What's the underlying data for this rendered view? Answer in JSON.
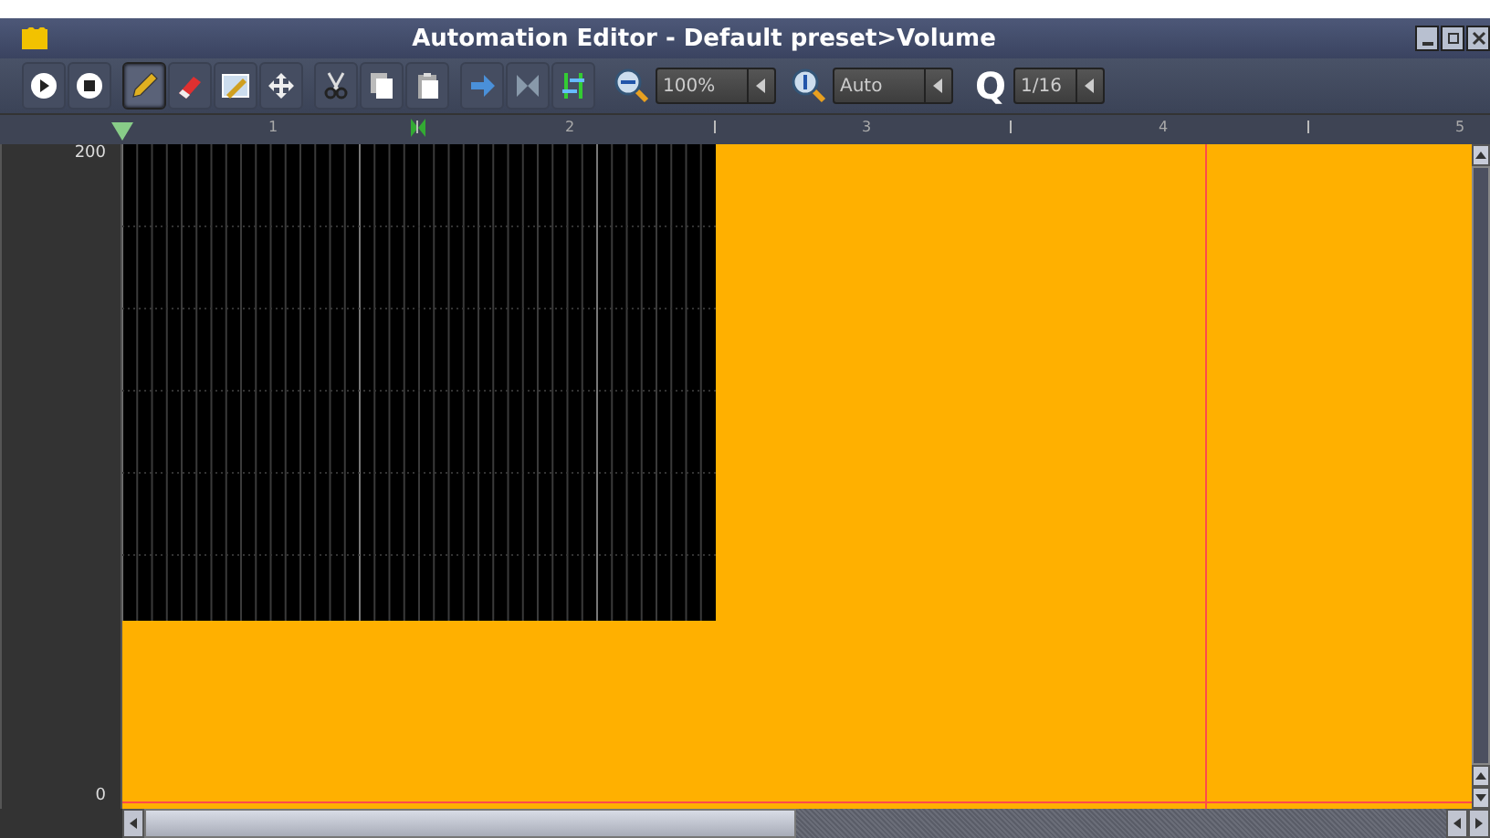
{
  "window": {
    "title": "Automation Editor - Default preset>Volume"
  },
  "toolbar": {
    "groups": [
      [
        {
          "kind": "play",
          "selected": false
        },
        {
          "kind": "stop",
          "selected": false
        }
      ],
      [
        {
          "kind": "pencil",
          "selected": true
        },
        {
          "kind": "eraser",
          "selected": false
        },
        {
          "kind": "select",
          "selected": false
        },
        {
          "kind": "move",
          "selected": false
        }
      ],
      [
        {
          "kind": "cut",
          "selected": false
        },
        {
          "kind": "copy",
          "selected": false
        },
        {
          "kind": "paste",
          "selected": false
        }
      ],
      [
        {
          "kind": "discrete",
          "selected": false
        },
        {
          "kind": "linear",
          "selected": false
        },
        {
          "kind": "cubic",
          "selected": false
        }
      ]
    ],
    "zoom_x": {
      "value": "100%"
    },
    "zoom_y": {
      "value": "Auto"
    },
    "quantize": {
      "label": "Q",
      "value": "1/16"
    }
  },
  "ruler": {
    "bars": [
      "1",
      "2",
      "3",
      "4",
      "5"
    ]
  },
  "axis": {
    "max": "200",
    "min": "0"
  }
}
